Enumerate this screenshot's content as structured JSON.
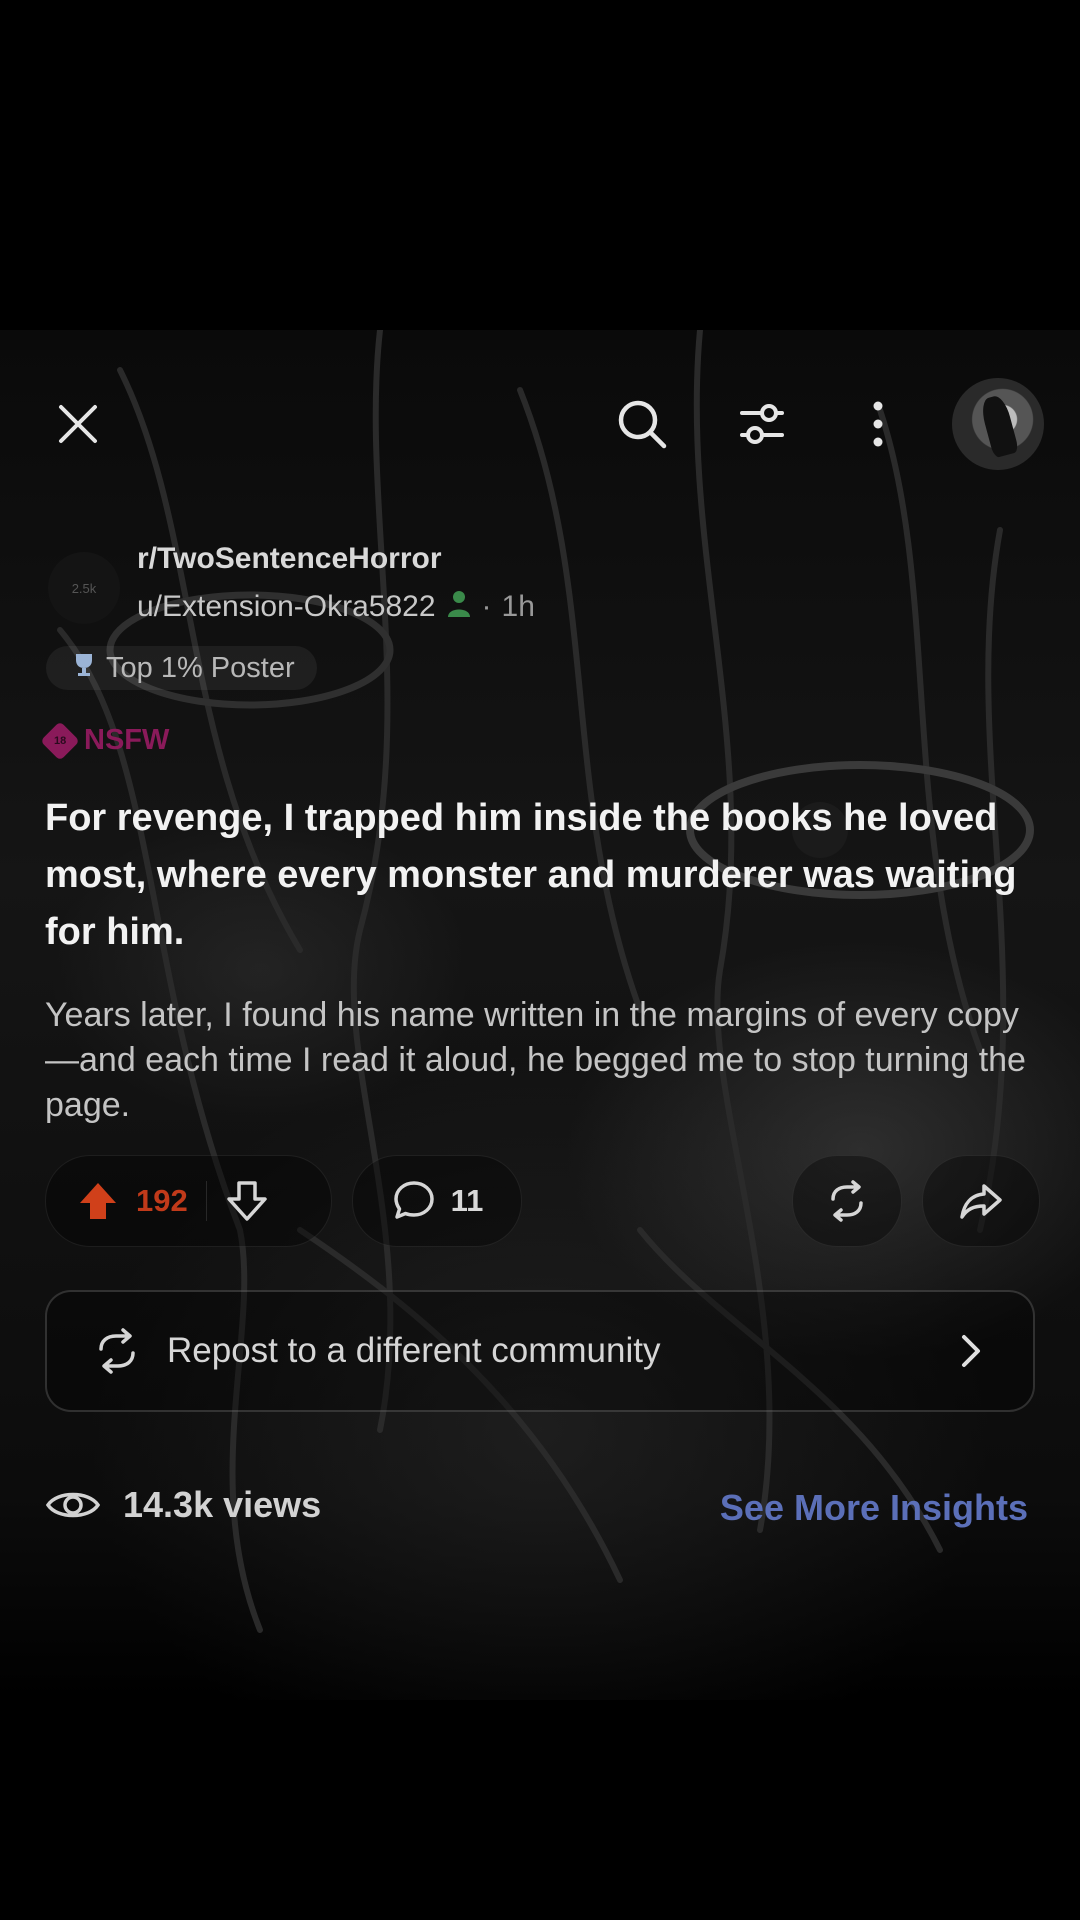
{
  "toolbar": {
    "close_icon": "close-icon",
    "search_icon": "search-icon",
    "sort_icon": "sort-icon",
    "more_icon": "more-vertical-icon"
  },
  "post": {
    "subreddit_icon_text": "2.5k",
    "subreddit": "r/TwoSentenceHorror",
    "author": "u/Extension-Okra5822",
    "separator": "·",
    "age": "1h",
    "flair": "Top 1% Poster",
    "nsfw_badge_text": "18",
    "nsfw_label": "NSFW",
    "title": "For revenge, I trapped him inside the books he loved most, where every monster and murderer was waiting for him.",
    "body": "Years later, I found his name written in the margins of every copy—and each time I read it aloud, he begged me to stop turning the page."
  },
  "actions": {
    "upvotes": "192",
    "comments": "11"
  },
  "repost": {
    "label": "Repost to a different community"
  },
  "insights": {
    "views": "14.3k views",
    "see_more": "See More Insights"
  },
  "colors": {
    "upvote": "#d0401a",
    "nsfw": "#8a1a5a",
    "link": "#5b6fb8"
  }
}
